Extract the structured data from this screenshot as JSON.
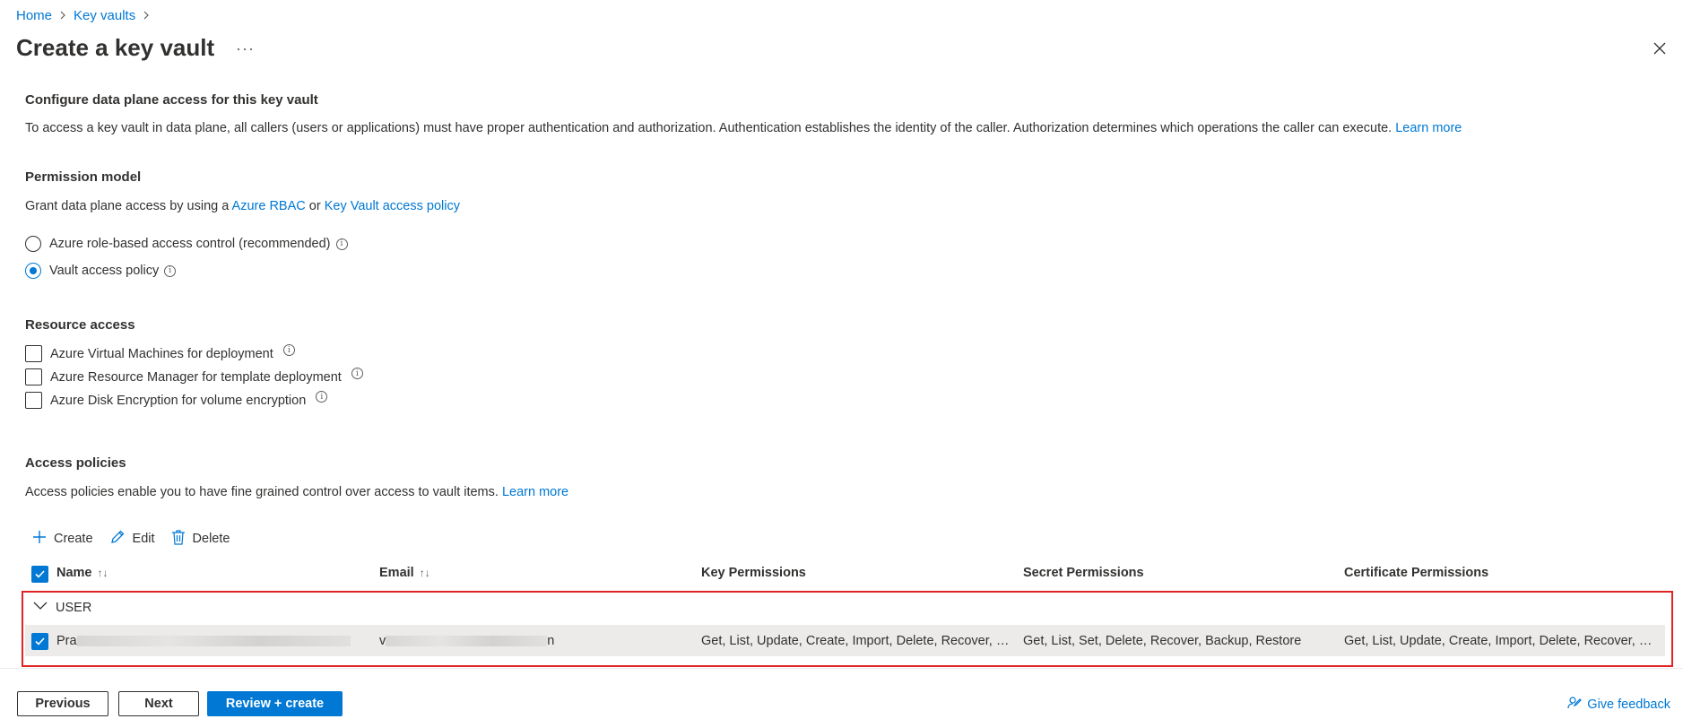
{
  "breadcrumb": {
    "home": "Home",
    "key_vaults": "Key vaults",
    "sep": ">"
  },
  "page": {
    "title": "Create a key vault",
    "more": "···"
  },
  "data_plane": {
    "heading": "Configure data plane access for this key vault",
    "description": "To access a key vault in data plane, all callers (users or applications) must have proper authentication and authorization. Authentication establishes the identity of the caller. Authorization determines which operations the caller can execute.",
    "learn_more": "Learn more"
  },
  "permission_model": {
    "heading": "Permission model",
    "grant_prefix": "Grant data plane access by using a",
    "rbac_link": "Azure RBAC",
    "or": "or",
    "policy_link": "Key Vault access policy",
    "options": [
      {
        "label": "Azure role-based access control (recommended)",
        "selected": false
      },
      {
        "label": "Vault access policy",
        "selected": true
      }
    ]
  },
  "resource_access": {
    "heading": "Resource access",
    "options": [
      {
        "label": "Azure Virtual Machines for deployment",
        "checked": false
      },
      {
        "label": "Azure Resource Manager for template deployment",
        "checked": false
      },
      {
        "label": "Azure Disk Encryption for volume encryption",
        "checked": false
      }
    ]
  },
  "access_policies": {
    "heading": "Access policies",
    "description": "Access policies enable you to have fine grained control over access to vault items.",
    "learn_more": "Learn more",
    "toolbar": {
      "create": "Create",
      "edit": "Edit",
      "delete": "Delete"
    },
    "columns": {
      "name": "Name",
      "email": "Email",
      "key": "Key Permissions",
      "secret": "Secret Permissions",
      "certificate": "Certificate Permissions"
    },
    "group": "USER",
    "row": {
      "name_prefix": "Pra",
      "email_prefix": "v",
      "email_suffix": "n",
      "key_permissions": "Get, List, Update, Create, Import, Delete, Recover, Ba...",
      "secret_permissions": "Get, List, Set, Delete, Recover, Backup, Restore",
      "certificate_permissions": "Get, List, Update, Create, Import, Delete, Recover, Ba..."
    }
  },
  "footer": {
    "previous": "Previous",
    "next": "Next",
    "review_create": "Review + create",
    "feedback": "Give feedback"
  },
  "colors": {
    "accent": "#0078d4",
    "highlight_border": "#e02424",
    "selected_row": "#edebe9"
  }
}
